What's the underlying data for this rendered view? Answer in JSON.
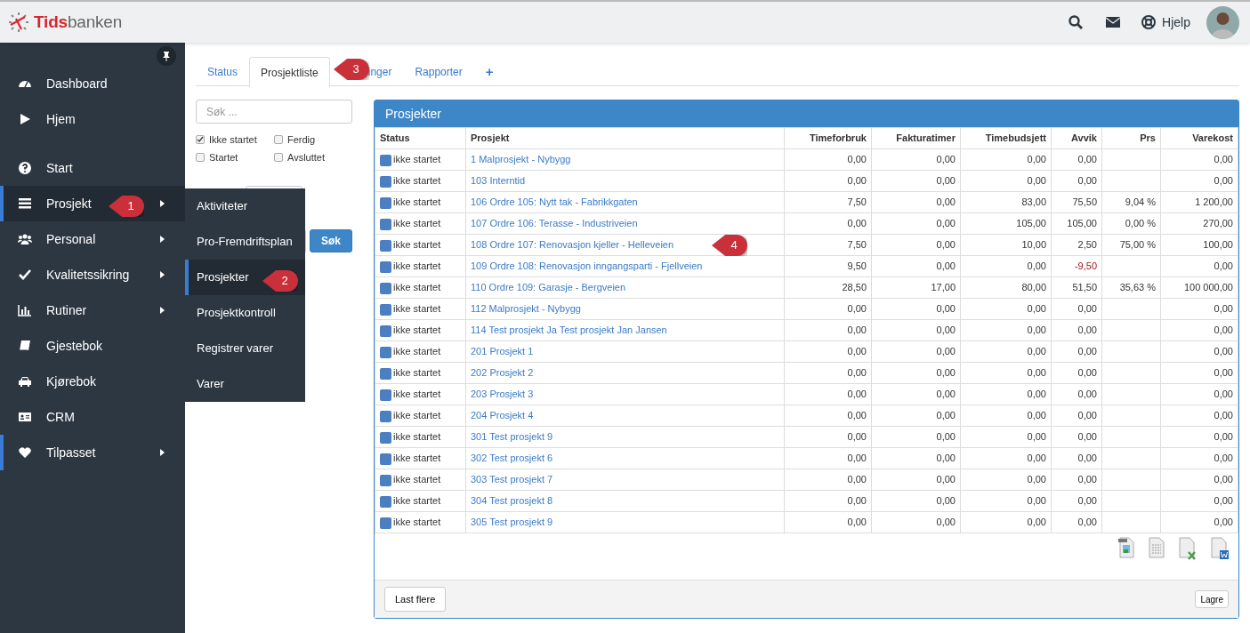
{
  "header": {
    "brand": "**Tids**banken",
    "help_label": "Hjelp"
  },
  "sidebar": {
    "sections": [
      [
        {
          "label": "Dashboard",
          "has_submenu": false,
          "selected": false,
          "expanded": false
        },
        {
          "label": "Hjem",
          "has_submenu": false,
          "selected": false,
          "expanded": false
        }
      ],
      [
        {
          "label": "Start",
          "has_submenu": false,
          "selected": false,
          "expanded": false
        },
        {
          "label": "Prosjekt",
          "has_submenu": true,
          "selected": true,
          "expanded": true
        },
        {
          "label": "Personal",
          "has_submenu": true,
          "selected": false,
          "expanded": false
        },
        {
          "label": "Kvalitetssikring",
          "has_submenu": true,
          "selected": false,
          "expanded": false
        },
        {
          "label": "Rutiner",
          "has_submenu": true,
          "selected": false,
          "expanded": false
        },
        {
          "label": "Gjestebok",
          "has_submenu": false,
          "selected": false,
          "expanded": false
        },
        {
          "label": "Kjørebok",
          "has_submenu": false,
          "selected": false,
          "expanded": false
        },
        {
          "label": "CRM",
          "has_submenu": false,
          "selected": false,
          "expanded": false
        },
        {
          "label": "Tilpasset",
          "has_submenu": true,
          "selected": true,
          "expanded": false
        }
      ]
    ]
  },
  "submenu": [
    {
      "label": "Aktiviteter",
      "selected": false
    },
    {
      "label": "Pro-Fremdriftsplan",
      "selected": false
    },
    {
      "label": "Prosjekter",
      "selected": true
    },
    {
      "label": "Prosjektkontroll",
      "selected": false
    },
    {
      "label": "Registrer varer",
      "selected": false
    },
    {
      "label": "Varer",
      "selected": false
    }
  ],
  "tabs": [
    {
      "label": "Status",
      "selected": false
    },
    {
      "label": "Prosjektliste",
      "selected": true
    },
    {
      "label": "inger",
      "selected": false
    },
    {
      "label": "Rapporter",
      "selected": false
    },
    {
      "label": "+",
      "selected": false
    }
  ],
  "filters": {
    "search": {
      "placeholder": "Søk ..."
    },
    "checkboxes": [
      {
        "label": "Ikke startet",
        "checked": true
      },
      {
        "label": "Ferdig",
        "checked": false
      },
      {
        "label": "Startet",
        "checked": false
      },
      {
        "label": "Avsluttet",
        "checked": false
      }
    ],
    "search_button": "Søk"
  },
  "panel": {
    "title": "Prosjekter",
    "columns": [
      "Status",
      "Prosjekt",
      "Timeforbruk",
      "Fakturatimer",
      "Timebudsjett",
      "Avvik",
      "Prs",
      "Varekost"
    ],
    "rows": [
      {
        "status": "ikke startet",
        "color": "#4a7fc1",
        "project": "1 Malprosjekt - Nybygg",
        "hours": "0,00",
        "billed": "0,00",
        "budget": "0,00",
        "deviation": "0,00",
        "goods_cost": "0,00",
        "negative": false
      },
      {
        "status": "ikke startet",
        "color": "#4a7fc1",
        "project": "103 Interntid",
        "hours": "0,00",
        "billed": "0,00",
        "budget": "0,00",
        "deviation": "0,00",
        "goods_cost": "0,00",
        "negative": false
      },
      {
        "status": "ikke startet",
        "color": "#4a7fc1",
        "project": "106 Ordre 105: Nytt tak - Fabrikkgaten",
        "hours": "7,50",
        "billed": "0,00",
        "budget": "83,00",
        "deviation": "75,50",
        "percent": "9,04 %",
        "goods_cost": "1 200,00",
        "negative": false
      },
      {
        "status": "ikke startet",
        "color": "#4a7fc1",
        "project": "107 Ordre 106: Terasse - Industriveien",
        "hours": "0,00",
        "billed": "0,00",
        "budget": "105,00",
        "deviation": "105,00",
        "percent": "0,00 %",
        "goods_cost": "270,00",
        "negative": false
      },
      {
        "status": "ikke startet",
        "color": "#4a7fc1",
        "project": "108 Ordre 107: Renovasjon kjeller - Helleveien",
        "hours": "7,50",
        "billed": "0,00",
        "budget": "10,00",
        "deviation": "2,50",
        "percent": "75,00 %",
        "goods_cost": "100,00",
        "negative": false
      },
      {
        "status": "ikke startet",
        "color": "#4a7fc1",
        "project": "109 Ordre 108: Renovasjon inngangsparti - Fjellveien",
        "hours": "9,50",
        "billed": "0,00",
        "budget": "0,00",
        "deviation": "-9,50",
        "goods_cost": "0,00",
        "negative": true
      },
      {
        "status": "ikke startet",
        "color": "#4a7fc1",
        "project": "110 Ordre 109: Garasje - Bergveien",
        "hours": "28,50",
        "billed": "17,00",
        "budget": "80,00",
        "deviation": "51,50",
        "percent": "35,63 %",
        "goods_cost": "100 000,00",
        "negative": false
      },
      {
        "status": "ikke startet",
        "color": "#4a7fc1",
        "project": "112 Malprosjekt - Nybygg",
        "hours": "0,00",
        "billed": "0,00",
        "budget": "0,00",
        "deviation": "0,00",
        "goods_cost": "0,00",
        "negative": false
      },
      {
        "status": "ikke startet",
        "color": "#4a7fc1",
        "project": "114 Test prosjekt Ja Test prosjekt Jan Jansen",
        "hours": "0,00",
        "billed": "0,00",
        "budget": "0,00",
        "deviation": "0,00",
        "goods_cost": "0,00",
        "negative": false
      },
      {
        "status": "ikke startet",
        "color": "#4a7fc1",
        "project": "201 Prosjekt 1",
        "hours": "0,00",
        "billed": "0,00",
        "budget": "0,00",
        "deviation": "0,00",
        "goods_cost": "0,00",
        "negative": false
      },
      {
        "status": "ikke startet",
        "color": "#4a7fc1",
        "project": "202 Prosjekt 2",
        "hours": "0,00",
        "billed": "0,00",
        "budget": "0,00",
        "deviation": "0,00",
        "goods_cost": "0,00",
        "negative": false
      },
      {
        "status": "ikke startet",
        "color": "#4a7fc1",
        "project": "203 Prosjekt 3",
        "hours": "0,00",
        "billed": "0,00",
        "budget": "0,00",
        "deviation": "0,00",
        "goods_cost": "0,00",
        "negative": false
      },
      {
        "status": "ikke startet",
        "color": "#4a7fc1",
        "project": "204 Prosjekt 4",
        "hours": "0,00",
        "billed": "0,00",
        "budget": "0,00",
        "deviation": "0,00",
        "goods_cost": "0,00",
        "negative": false
      },
      {
        "status": "ikke startet",
        "color": "#4a7fc1",
        "project": "301 Test prosjekt 9",
        "hours": "0,00",
        "billed": "0,00",
        "budget": "0,00",
        "deviation": "0,00",
        "goods_cost": "0,00",
        "negative": false
      },
      {
        "status": "ikke startet",
        "color": "#4a7fc1",
        "project": "302 Test prosjekt 6",
        "hours": "0,00",
        "billed": "0,00",
        "budget": "0,00",
        "deviation": "0,00",
        "goods_cost": "0,00",
        "negative": false
      },
      {
        "status": "ikke startet",
        "color": "#4a7fc1",
        "project": "303 Test prosjekt 7",
        "hours": "0,00",
        "billed": "0,00",
        "budget": "0,00",
        "deviation": "0,00",
        "goods_cost": "0,00",
        "negative": false
      },
      {
        "status": "ikke startet",
        "color": "#4a7fc1",
        "project": "304 Test prosjekt 8",
        "hours": "0,00",
        "billed": "0,00",
        "budget": "0,00",
        "deviation": "0,00",
        "goods_cost": "0,00",
        "negative": false
      },
      {
        "status": "ikke startet",
        "color": "#4a7fc1",
        "project": "305 Test prosjekt 9",
        "hours": "0,00",
        "billed": "0,00",
        "budget": "0,00",
        "deviation": "0,00",
        "goods_cost": "0,00",
        "negative": false
      }
    ],
    "load_more": "Last flere",
    "save": "Lagre"
  },
  "callouts": [
    {
      "number": "1"
    },
    {
      "number": "2"
    },
    {
      "number": "3"
    },
    {
      "number": "4"
    }
  ]
}
